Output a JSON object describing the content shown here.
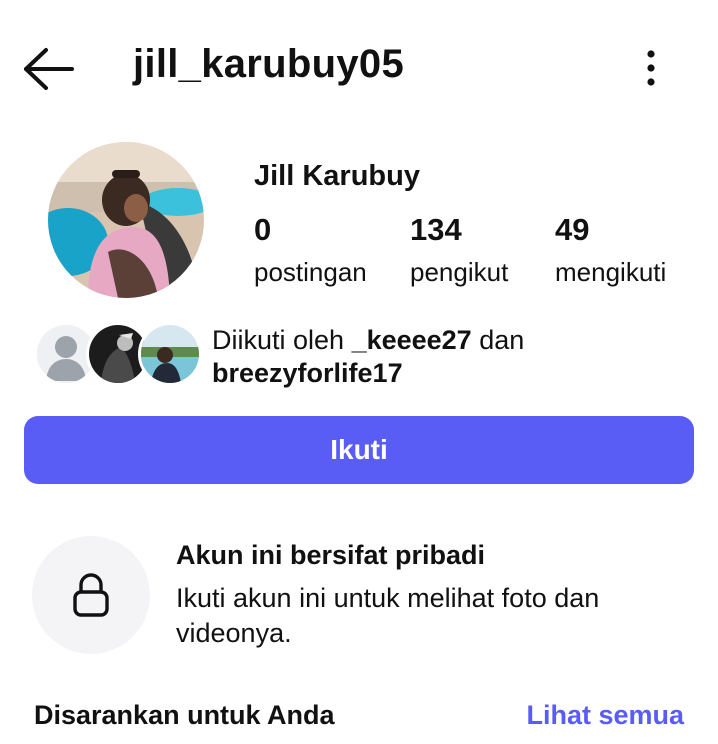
{
  "header": {
    "back_icon": "arrow-left-icon",
    "username": "jill_karubuy05",
    "more_icon": "more-vertical-icon"
  },
  "profile": {
    "display_name": "Jill Karubuy",
    "stats": {
      "posts": {
        "value": "0",
        "label": "postingan"
      },
      "followers": {
        "value": "134",
        "label": "pengikut"
      },
      "following": {
        "value": "49",
        "label": "mengikuti"
      }
    }
  },
  "mutual_followers": {
    "prefix": "Diikuti oleh ",
    "user1": "_keeee27",
    "conjunction": " dan",
    "user2": "breezyforlife17"
  },
  "follow_button": {
    "label": "Ikuti",
    "color": "#5a5cf6"
  },
  "private_notice": {
    "icon": "lock-icon",
    "title": "Akun ini bersifat pribadi",
    "description": "Ikuti akun ini untuk melihat foto dan videonya."
  },
  "suggestions": {
    "title": "Disarankan untuk Anda",
    "see_all": "Lihat semua",
    "accent": "#5a5cf6"
  }
}
